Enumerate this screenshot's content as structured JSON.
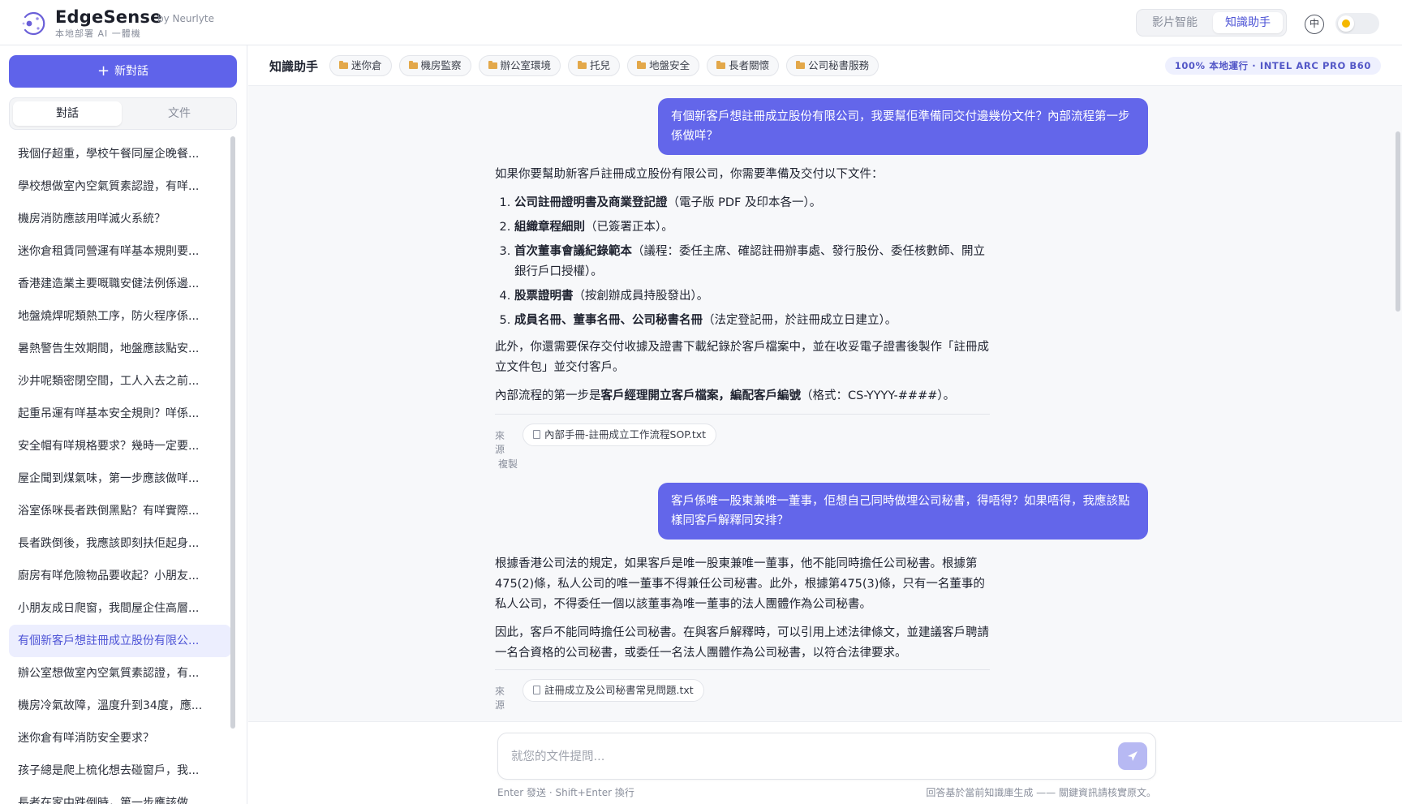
{
  "brand": {
    "name": "EdgeSense",
    "by": "by Neurlyte",
    "tagline": "本地部署 AI 一體機"
  },
  "header": {
    "modes": {
      "video": "影片智能",
      "knowledge": "知識助手",
      "active": "knowledge"
    },
    "lang_label": "中",
    "theme": "light"
  },
  "sidebar": {
    "new_chat_label": "新對話",
    "tabs": {
      "chats": "對話",
      "documents": "文件",
      "active": "chats"
    },
    "conversations": [
      "我個仔超重，學校午餐同屋企晚餐...",
      "學校想做室內空氣質素認證，有咩...",
      "機房消防應該用咩滅火系統？",
      "迷你倉租賃同營運有咩基本規則要...",
      "香港建造業主要嘅職安健法例係邊...",
      "地盤燒焊呢類熱工序，防火程序係...",
      "暑熱警告生效期間，地盤應該點安...",
      "沙井呢類密閉空間，工人入去之前...",
      "起重吊運有咩基本安全規則？咩係...",
      "安全帽有咩規格要求？幾時一定要...",
      "屋企聞到煤氣味，第一步應該做咩...",
      "浴室係咪長者跌倒黑點？有咩實際...",
      "長者跌倒後，我應該即刻扶佢起身...",
      "廚房有咩危險物品要收起？小朋友...",
      "小朋友成日爬窗，我間屋企住高層...",
      "有個新客戶想註冊成立股份有限公...",
      "辦公室想做室內空氣質素認證，有...",
      "機房冷氣故障，溫度升到34度，應...",
      "迷你倉有咩消防安全要求？",
      "孩子總是爬上梳化想去碰窗戶，我...",
      "長者在家中跌倒時，第一步應該做..."
    ],
    "active_index": 15
  },
  "topics": {
    "title": "知識助手",
    "chips": [
      "迷你倉",
      "機房監察",
      "辦公室環境",
      "托兒",
      "地盤安全",
      "長者關懷",
      "公司秘書服務"
    ],
    "runtime_badge": "100% 本地運行 · INTEL ARC PRO B60"
  },
  "messages": [
    {
      "role": "user",
      "text": "有個新客戶想註冊成立股份有限公司，我要幫佢準備同交付邊幾份文件？內部流程第一步係做咩？"
    },
    {
      "role": "assistant",
      "intro": "如果你要幫助新客戶註冊成立股份有限公司，你需要準備及交付以下文件：",
      "list": [
        {
          "bold": "公司註冊證明書及商業登記證",
          "rest": "（電子版 PDF 及印本各一）。"
        },
        {
          "bold": "組織章程細則",
          "rest": "（已簽署正本）。"
        },
        {
          "bold": "首次董事會議紀錄範本",
          "rest": "（議程：委任主席、確認註冊辦事處、發行股份、委任核數師、開立銀行戶口授權）。"
        },
        {
          "bold": "股票證明書",
          "rest": "（按創辦成員持股發出）。"
        },
        {
          "bold": "成員名冊、董事名冊、公司秘書名冊",
          "rest": "（法定登記冊，於註冊成立日建立）。"
        }
      ],
      "para2": "此外，你還需要保存交付收據及證書下載紀錄於客戶檔案中，並在收妥電子證書後製作「註冊成立文件包」並交付客戶。",
      "para3_pre": "內部流程的第一步是",
      "para3_bold": "客戶經理開立客戶檔案，編配客戶編號",
      "para3_post": "（格式：CS-YYYY-####）。",
      "source_label": "來源",
      "source_file": "內部手冊-註冊成立工作流程SOP.txt",
      "copy_label": "複製"
    },
    {
      "role": "user",
      "text": "客戶係唯一股東兼唯一董事，佢想自己同時做埋公司秘書，得唔得？如果唔得，我應該點樣同客戶解釋同安排？"
    },
    {
      "role": "assistant",
      "para1": "根據香港公司法的規定，如果客戶是唯一股東兼唯一董事，他不能同時擔任公司秘書。根據第475(2)條，私人公司的唯一董事不得兼任公司秘書。此外，根據第475(3)條，只有一名董事的私人公司，不得委任一個以該董事為唯一董事的法人團體作為公司秘書。",
      "para2": "因此，客戶不能同時擔任公司秘書。在與客戶解釋時，可以引用上述法律條文，並建議客戶聘請一名合資格的公司秘書，或委任一名法人團體作為公司秘書，以符合法律要求。",
      "source_label": "來源",
      "source_file": "註冊成立及公司秘書常見問題.txt"
    }
  ],
  "composer": {
    "placeholder": "就您的文件提問...",
    "hint_left": "Enter 發送 · Shift+Enter 換行",
    "hint_right": "回答基於當前知識庫生成 —— 關鍵資訊請核實原文。"
  },
  "colors": {
    "accent": "#5f63ea",
    "user_bubble": "#6366ea",
    "active_item_bg": "#eceefe",
    "chip_folder": "#e3a84a"
  }
}
